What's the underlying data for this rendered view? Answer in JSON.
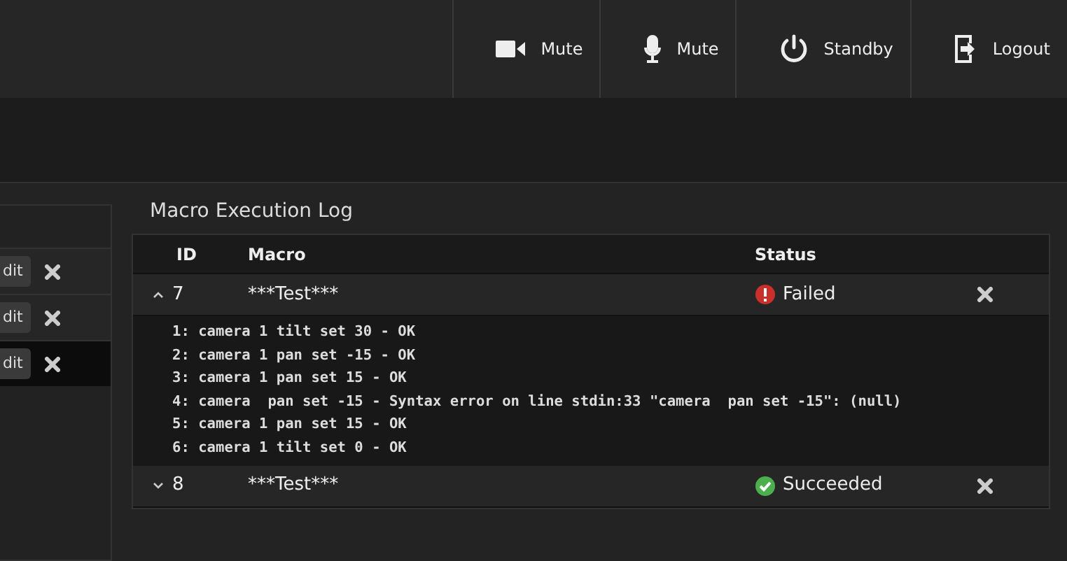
{
  "topbar": {
    "buttons": [
      {
        "kind": "camera",
        "label": "Mute"
      },
      {
        "kind": "mic",
        "label": "Mute"
      },
      {
        "kind": "power",
        "label": "Standby"
      },
      {
        "kind": "logout",
        "label": "Logout"
      }
    ]
  },
  "left_panel": {
    "rows": [
      {
        "button": "dit",
        "selected": false
      },
      {
        "button": "dit",
        "selected": false
      },
      {
        "button": "dit",
        "selected": true
      }
    ]
  },
  "log": {
    "title": "Macro Execution Log",
    "columns": [
      "ID",
      "Macro",
      "Status"
    ],
    "entries": [
      {
        "id": "7",
        "macro": "***Test***",
        "status": "Failed",
        "kind": "failed",
        "expanded": true,
        "lines": [
          "1: camera 1 tilt set 30 - OK",
          "2: camera 1 pan set -15 - OK",
          "3: camera 1 pan set 15 - OK",
          "4: camera  pan set -15 - Syntax error on line stdin:33 \"camera  pan set -15\": (null)",
          "5: camera 1 pan set 15 - OK",
          "6: camera 1 tilt set 0 - OK"
        ]
      },
      {
        "id": "8",
        "macro": "***Test***",
        "status": "Succeeded",
        "kind": "succeeded",
        "expanded": false
      }
    ]
  }
}
